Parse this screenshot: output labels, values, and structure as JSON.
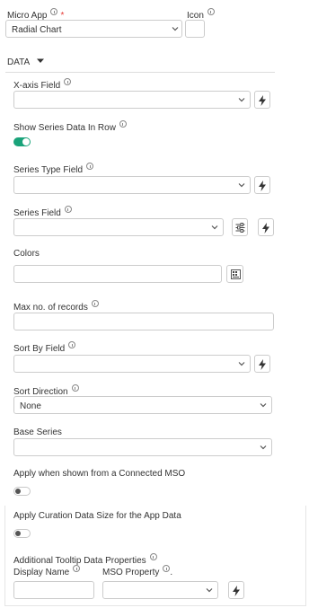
{
  "micro_app": {
    "label": "Micro App",
    "required_mark": "*",
    "value": "Radial Chart"
  },
  "icon_field": {
    "label": "Icon"
  },
  "data_section": {
    "label": "DATA"
  },
  "x_axis_field": {
    "label": "X-axis Field",
    "value": ""
  },
  "show_series_row": {
    "label": "Show Series Data In Row",
    "enabled": true
  },
  "series_type_field": {
    "label": "Series Type Field",
    "value": ""
  },
  "series_field": {
    "label": "Series Field",
    "value": ""
  },
  "colors": {
    "label": "Colors",
    "value": ""
  },
  "max_records": {
    "label": "Max no. of records",
    "value": ""
  },
  "sort_by_field": {
    "label": "Sort By Field",
    "value": ""
  },
  "sort_direction": {
    "label": "Sort Direction",
    "value": "None"
  },
  "base_series": {
    "label": "Base Series",
    "value": ""
  },
  "apply_connected_mso": {
    "label": "Apply when shown from a Connected MSO",
    "enabled": false
  },
  "apply_curation": {
    "label": "Apply Curation Data Size for the App Data",
    "enabled": false
  },
  "tooltip": {
    "label": "Additional Tooltip Data Properties",
    "display_name_label": "Display Name",
    "mso_property_label": "MSO Property",
    "mso_property_suffix": ".",
    "display_name_value": "",
    "mso_property_value": ""
  },
  "icons": {
    "dropdown": "chevron-down-icon",
    "lightning": "lightning-bolt-icon",
    "settings": "sliders-icon",
    "palette": "color-palette-icon",
    "info": "info-icon",
    "caret": "caret-down-icon"
  },
  "colors_theme": {
    "toggle_on": "#1aa37a",
    "required": "#e53935",
    "border": "#cccccc"
  }
}
